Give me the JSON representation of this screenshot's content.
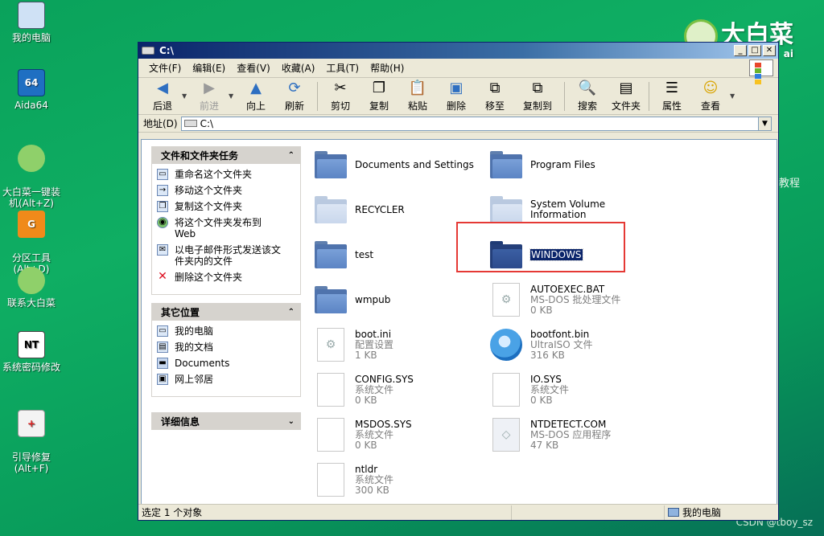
{
  "desktop": {
    "icons": [
      {
        "label": "我的电脑"
      },
      {
        "label": "Aida64"
      },
      {
        "label": "大白菜一键装\n机(Alt+Z)"
      },
      {
        "label": "分区工具\n(Alt+D)"
      },
      {
        "label": "联系大白菜"
      },
      {
        "label": "系统密码修改"
      },
      {
        "label": "引导修复\n(Alt+F)"
      }
    ],
    "brand": "大白菜",
    "brand_sub": "ai",
    "side_text": "教程",
    "watermark": "CSDN @tboy_sz"
  },
  "window": {
    "title": "C:\\",
    "menu": [
      "文件(F)",
      "编辑(E)",
      "查看(V)",
      "收藏(A)",
      "工具(T)",
      "帮助(H)"
    ],
    "toolbar": {
      "back": "后退",
      "forward": "前进",
      "up": "向上",
      "refresh": "刷新",
      "cut": "剪切",
      "copy": "复制",
      "paste": "粘贴",
      "delete": "删除",
      "move_to": "移至",
      "copy_to": "复制到",
      "search": "搜索",
      "folders": "文件夹",
      "properties": "属性",
      "view": "查看"
    },
    "address": {
      "label": "地址(D)",
      "value": "C:\\"
    },
    "tasks": {
      "file_tasks": {
        "title": "文件和文件夹任务",
        "items": [
          "重命名这个文件夹",
          "移动这个文件夹",
          "复制这个文件夹",
          "将这个文件夹发布到\nWeb",
          "以电子邮件形式发送该文\n件夹内的文件",
          "删除这个文件夹"
        ]
      },
      "other_places": {
        "title": "其它位置",
        "items": [
          "我的电脑",
          "我的文档",
          "Documents",
          "网上邻居"
        ]
      },
      "details": {
        "title": "详细信息"
      }
    },
    "files": [
      {
        "name": "Documents and Settings"
      },
      {
        "name": "Program Files"
      },
      {
        "name": "RECYCLER"
      },
      {
        "name": "System Volume Information"
      },
      {
        "name": "test"
      },
      {
        "name": "WINDOWS"
      },
      {
        "name": "wmpub"
      },
      {
        "name": "AUTOEXEC.BAT",
        "type": "MS-DOS 批处理文件",
        "size": "0 KB"
      },
      {
        "name": "boot.ini",
        "type": "配置设置",
        "size": "1 KB"
      },
      {
        "name": "bootfont.bin",
        "type": "UltraISO 文件",
        "size": "316 KB"
      },
      {
        "name": "CONFIG.SYS",
        "type": "系统文件",
        "size": "0 KB"
      },
      {
        "name": "IO.SYS",
        "type": "系统文件",
        "size": "0 KB"
      },
      {
        "name": "MSDOS.SYS",
        "type": "系统文件",
        "size": "0 KB"
      },
      {
        "name": "NTDETECT.COM",
        "type": "MS-DOS 应用程序",
        "size": "47 KB"
      },
      {
        "name": "ntldr",
        "type": "系统文件",
        "size": "300 KB"
      }
    ],
    "status": {
      "left": "选定 1 个对象",
      "right": "我的电脑"
    }
  }
}
